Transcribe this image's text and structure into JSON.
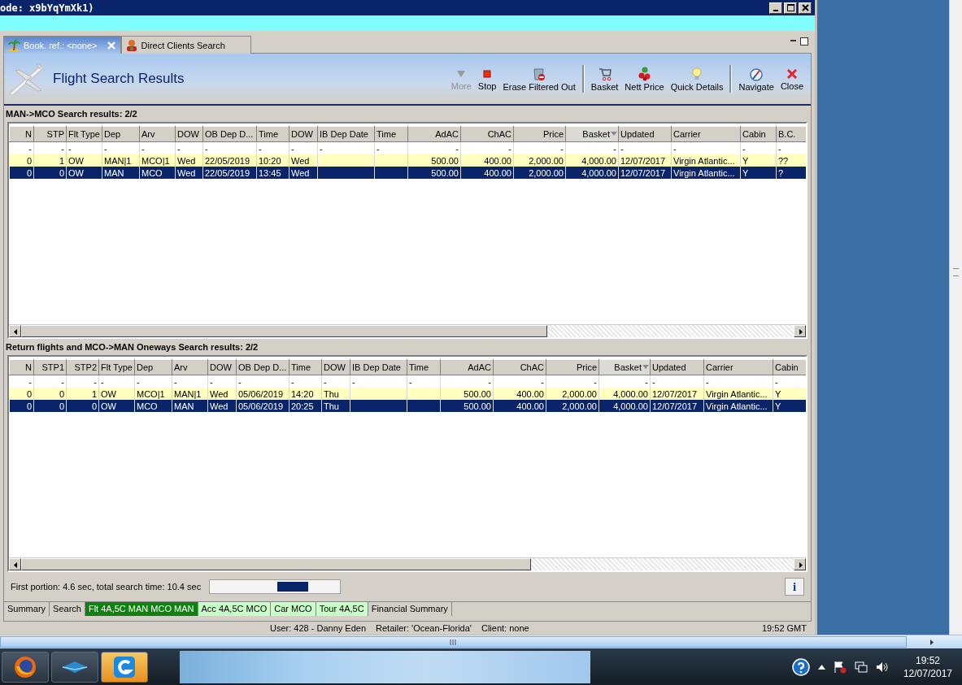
{
  "window": {
    "title": "ode: x9bYqYmXk1)"
  },
  "tabs": [
    {
      "label": "Book. ref.: <none>",
      "selected": true,
      "closable": true
    },
    {
      "label": "Direct Clients Search",
      "selected": false,
      "closable": false
    }
  ],
  "header": {
    "title": "Flight Search Results"
  },
  "toolbar": [
    [
      {
        "label": "More",
        "disabled": true
      },
      {
        "label": "Stop",
        "disabled": false
      },
      {
        "label": "Erase Filtered Out",
        "disabled": false
      }
    ],
    [
      {
        "label": "Basket",
        "disabled": false
      },
      {
        "label": "Nett Price",
        "disabled": false
      },
      {
        "label": "Quick Details",
        "disabled": false
      }
    ],
    [
      {
        "label": "Navigate",
        "disabled": false
      },
      {
        "label": "Close",
        "disabled": false
      }
    ]
  ],
  "sections": [
    {
      "heading": "MAN->MCO Search results: 2/2",
      "columns": [
        {
          "label": "N",
          "kind": "number",
          "sorted": false
        },
        {
          "label": "STP",
          "kind": "number",
          "sorted": false
        },
        {
          "label": "Flt Type",
          "kind": "text",
          "sorted": false
        },
        {
          "label": "Dep",
          "kind": "text",
          "sorted": false
        },
        {
          "label": "Arv",
          "kind": "text",
          "sorted": false
        },
        {
          "label": "DOW",
          "kind": "text",
          "sorted": false
        },
        {
          "label": "OB Dep D...",
          "kind": "text",
          "sorted": false
        },
        {
          "label": "Time",
          "kind": "text",
          "sorted": false
        },
        {
          "label": "DOW",
          "kind": "text",
          "sorted": false
        },
        {
          "label": "IB Dep Date",
          "kind": "text",
          "sorted": false
        },
        {
          "label": "Time",
          "kind": "text",
          "sorted": false
        },
        {
          "label": "AdAC",
          "kind": "number",
          "sorted": false
        },
        {
          "label": "ChAC",
          "kind": "number",
          "sorted": false
        },
        {
          "label": "Price",
          "kind": "number",
          "sorted": false
        },
        {
          "label": "Basket",
          "kind": "number",
          "sorted": true
        },
        {
          "label": "Updated",
          "kind": "text",
          "sorted": false
        },
        {
          "label": "Carrier",
          "kind": "text",
          "sorted": false
        },
        {
          "label": "Cabin",
          "kind": "text",
          "sorted": false
        },
        {
          "label": "B.C.",
          "kind": "text",
          "sorted": false
        }
      ],
      "rows": [
        {
          "kind": "filter",
          "selected": false,
          "cells": [
            "-",
            "-",
            "-",
            "-",
            "-",
            "-",
            "-",
            "-",
            "-",
            "-",
            "-",
            "-",
            "-",
            "-",
            "-",
            "-",
            "-",
            "-",
            "-"
          ]
        },
        {
          "kind": "result",
          "selected": false,
          "cells": [
            "0",
            "1",
            "OW",
            "MAN|1",
            "MCO|1",
            "Wed",
            "22/05/2019",
            "10:20",
            "Wed",
            null,
            null,
            "500.00",
            "400.00",
            "2,000.00",
            "4,000.00",
            "12/07/2017",
            "Virgin Atlantic...",
            "Y",
            "??"
          ]
        },
        {
          "kind": "result",
          "selected": true,
          "cells": [
            "0",
            "0",
            "OW",
            "MAN",
            "MCO",
            "Wed",
            "22/05/2019",
            "13:45",
            "Wed",
            null,
            null,
            "500.00",
            "400.00",
            "2,000.00",
            "4,000.00",
            "12/07/2017",
            "Virgin Atlantic...",
            "Y",
            "?"
          ]
        }
      ]
    },
    {
      "heading": "Return flights and MCO->MAN Oneways Search results: 2/2",
      "columns": [
        {
          "label": "N",
          "kind": "number",
          "sorted": false
        },
        {
          "label": "STP1",
          "kind": "number",
          "sorted": false
        },
        {
          "label": "STP2",
          "kind": "number",
          "sorted": false
        },
        {
          "label": "Flt Type",
          "kind": "text",
          "sorted": false
        },
        {
          "label": "Dep",
          "kind": "text",
          "sorted": false
        },
        {
          "label": "Arv",
          "kind": "text",
          "sorted": false
        },
        {
          "label": "DOW",
          "kind": "text",
          "sorted": false
        },
        {
          "label": "OB Dep D...",
          "kind": "text",
          "sorted": false
        },
        {
          "label": "Time",
          "kind": "text",
          "sorted": false
        },
        {
          "label": "DOW",
          "kind": "text",
          "sorted": false
        },
        {
          "label": "IB Dep Date",
          "kind": "text",
          "sorted": false
        },
        {
          "label": "Time",
          "kind": "text",
          "sorted": false
        },
        {
          "label": "AdAC",
          "kind": "number",
          "sorted": false
        },
        {
          "label": "ChAC",
          "kind": "number",
          "sorted": false
        },
        {
          "label": "Price",
          "kind": "number",
          "sorted": false
        },
        {
          "label": "Basket",
          "kind": "number",
          "sorted": true
        },
        {
          "label": "Updated",
          "kind": "text",
          "sorted": false
        },
        {
          "label": "Carrier",
          "kind": "text",
          "sorted": false
        },
        {
          "label": "Cabin",
          "kind": "text",
          "sorted": false
        }
      ],
      "rows": [
        {
          "kind": "filter",
          "selected": false,
          "cells": [
            "-",
            "-",
            "-",
            "-",
            "-",
            "-",
            "-",
            "-",
            "-",
            "-",
            "-",
            "-",
            "-",
            "-",
            "-",
            "-",
            "-",
            "-",
            "-"
          ]
        },
        {
          "kind": "result",
          "selected": false,
          "cells": [
            "0",
            "0",
            "1",
            "OW",
            "MCO|1",
            "MAN|1",
            "Wed",
            "05/06/2019",
            "14:20",
            "Thu",
            null,
            null,
            "500.00",
            "400.00",
            "2,000.00",
            "4,000.00",
            "12/07/2017",
            "Virgin Atlantic...",
            "Y"
          ]
        },
        {
          "kind": "result",
          "selected": true,
          "cells": [
            "0",
            "0",
            "0",
            "OW",
            "MCO",
            "MAN",
            "Wed",
            "05/06/2019",
            "20:25",
            "Thu",
            null,
            null,
            "500.00",
            "400.00",
            "2,000.00",
            "4,000.00",
            "12/07/2017",
            "Virgin Atlantic...",
            "Y"
          ]
        }
      ]
    }
  ],
  "footer": {
    "timing": "First portion: 4.6 sec, total search time: 10.4 sec",
    "info_button": "i"
  },
  "bottom_tabs": [
    {
      "label": "Summary",
      "kind": "plain",
      "selected": false
    },
    {
      "label": "Search",
      "kind": "plain",
      "selected": false
    },
    {
      "label": "Flt 4A,5C MAN MCO MAN",
      "kind": "component",
      "selected": true
    },
    {
      "label": "Acc 4A,5C MCO",
      "kind": "component",
      "selected": false
    },
    {
      "label": "Car MCO",
      "kind": "component",
      "selected": false
    },
    {
      "label": "Tour 4A,5C",
      "kind": "component",
      "selected": false
    },
    {
      "label": "Financial Summary",
      "kind": "plain",
      "selected": false
    }
  ],
  "status_bar": {
    "user": "User: 428 - Danny Eden",
    "retailer": "Retailer: 'Ocean-Florida'",
    "client": "Client: none",
    "time": "19:52 GMT"
  },
  "taskbar": {
    "clock_time": "19:52",
    "clock_date": "12/07/2017"
  }
}
